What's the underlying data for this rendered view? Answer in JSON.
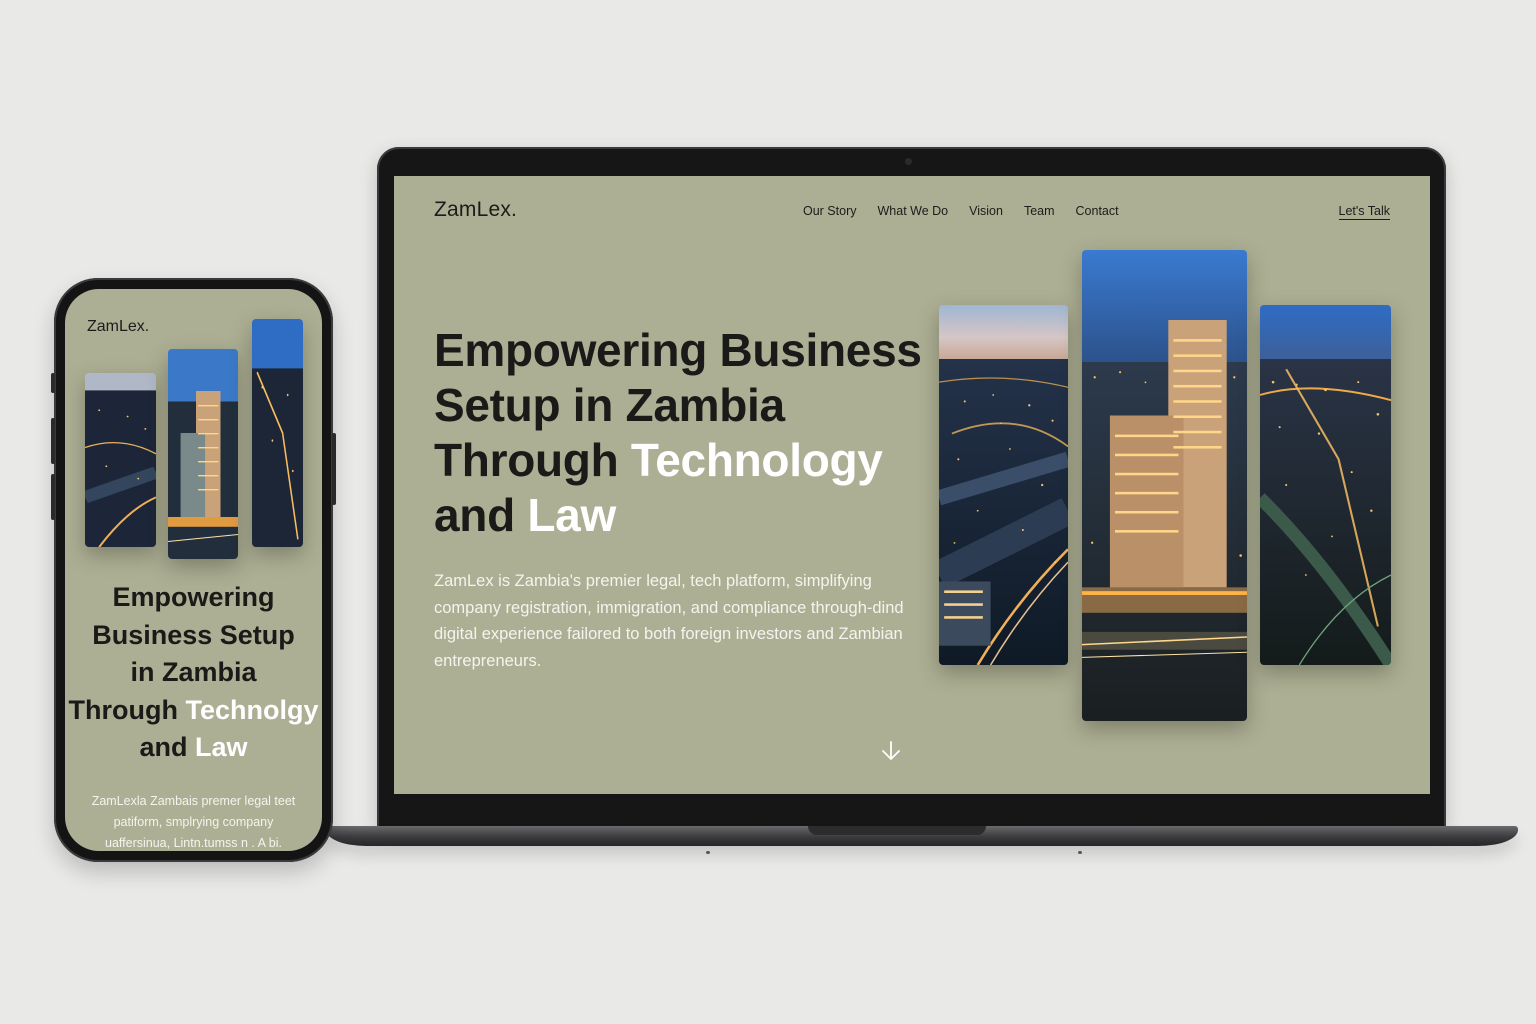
{
  "laptop": {
    "site": {
      "logo": "ZamLex.",
      "nav": [
        "Our Story",
        "What We Do",
        "Vision",
        "Team",
        "Contact"
      ],
      "cta": "Let's Talk",
      "hero_title_lines": [
        [
          "Empowering Business"
        ],
        [
          "Setup in Zambia"
        ],
        [
          "Through ",
          "Technology"
        ],
        [
          "and ",
          "Law"
        ]
      ],
      "hero_description": "ZamLex is Zambia's premier legal, tech platform, simplifying company registration, immigration, and compliance through-dind digital experience failored to both foreign investors and Zambian entrepreneurs.",
      "scroll_icon": "arrow-down-icon",
      "images": [
        "city-night-aerial",
        "building-tower-night",
        "city-lights-aerial"
      ]
    }
  },
  "phone": {
    "logo": "ZamLex.",
    "hero_title_lines": [
      [
        "Empowering"
      ],
      [
        "Business Setup"
      ],
      [
        "in Zambia"
      ],
      [
        "Through ",
        "Technolgy"
      ],
      [
        "and ",
        "Law"
      ]
    ],
    "hero_description": "ZamLexla Zambais premer legal teet patiform, smplrying company uaffersinua, Lintn.tumss n . A bi.",
    "images": [
      "city-night-aerial",
      "building-tower-night",
      "city-lights-aerial"
    ]
  },
  "colors": {
    "page_bg": "#e9e9e7",
    "site_bg": "#adaf94",
    "heading": "#1a1a18",
    "highlight": "#ffffff",
    "device_frame": "#161617"
  }
}
